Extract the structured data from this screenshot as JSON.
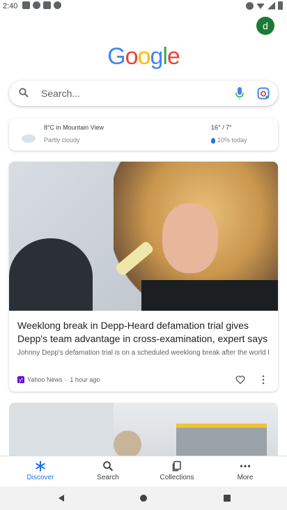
{
  "status_bar": {
    "time": "2:40"
  },
  "account": {
    "initial": "d"
  },
  "logo": {
    "letters": [
      "G",
      "o",
      "o",
      "g",
      "l",
      "e"
    ],
    "colors": [
      "#4285f4",
      "#ea4335",
      "#fbbc05",
      "#4285f4",
      "#34a853",
      "#ea4335"
    ]
  },
  "search": {
    "placeholder": "Search..."
  },
  "weather": {
    "temperature_location": "8°C in Mountain View",
    "condition": "Partly cloudy",
    "high_low": "16° / 7°",
    "rain_chance": "10% today"
  },
  "news": {
    "title": "Weeklong break in Depp-Heard defamation trial gives Depp's team advantage in cross-examination, expert says",
    "snippet": "Johnny Depp's defamation trial is on a scheduled weeklong break after the world listened to a parade of witnesses, including Amber Heard, testify in recent ...",
    "publisher": "Yahoo News",
    "publisher_logo_letter": "y!",
    "age": "1 hour ago"
  },
  "bottom_nav": {
    "discover": "Discover",
    "search": "Search",
    "collections": "Collections",
    "more": "More"
  },
  "colors": {
    "accent": "#1a73e8",
    "avatar": "#1e7a33"
  }
}
